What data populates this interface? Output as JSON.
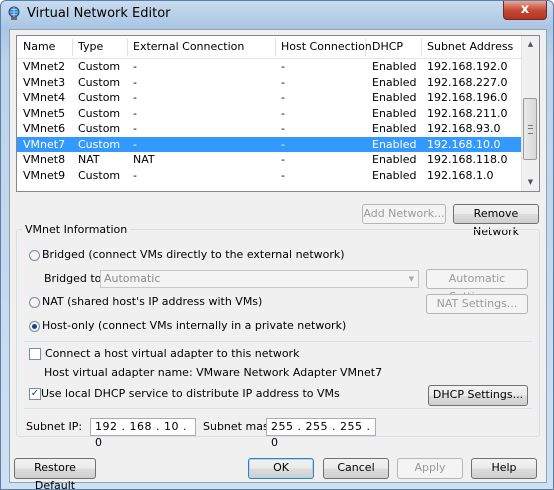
{
  "window": {
    "title": "Virtual Network Editor",
    "close_glyph": "x"
  },
  "table": {
    "headers": [
      "Name",
      "Type",
      "External Connection",
      "Host Connection",
      "DHCP",
      "Subnet Address"
    ],
    "rows": [
      [
        "VMnet2",
        "Custom",
        "-",
        "-",
        "Enabled",
        "192.168.192.0"
      ],
      [
        "VMnet3",
        "Custom",
        "-",
        "-",
        "Enabled",
        "192.168.227.0"
      ],
      [
        "VMnet4",
        "Custom",
        "-",
        "-",
        "Enabled",
        "192.168.196.0"
      ],
      [
        "VMnet5",
        "Custom",
        "-",
        "-",
        "Enabled",
        "192.168.211.0"
      ],
      [
        "VMnet6",
        "Custom",
        "-",
        "-",
        "Enabled",
        "192.168.93.0"
      ],
      [
        "VMnet7",
        "Custom",
        "-",
        "-",
        "Enabled",
        "192.168.10.0"
      ],
      [
        "VMnet8",
        "NAT",
        "NAT",
        "-",
        "Enabled",
        "192.168.118.0"
      ],
      [
        "VMnet9",
        "Custom",
        "-",
        "-",
        "Enabled",
        "192.168.1.0"
      ]
    ],
    "selected_row": "VMnet7"
  },
  "buttons": {
    "add_network": "Add Network...",
    "remove_network": "Remove Network",
    "automatic_settings": "Automatic Settings...",
    "nat_settings": "NAT Settings...",
    "dhcp_settings": "DHCP Settings...",
    "restore_default": "Restore Default",
    "ok": "OK",
    "cancel": "Cancel",
    "apply": "Apply",
    "help": "Help"
  },
  "vmnet_info": {
    "group_title": "VMnet Information",
    "bridged_label": "Bridged (connect VMs directly to the external network)",
    "bridged_to_label": "Bridged to:",
    "bridged_to_value": "Automatic",
    "nat_label": "NAT (shared host's IP address with VMs)",
    "host_only_label": "Host-only (connect VMs internally in a private network)",
    "selected_mode": "host-only",
    "connect_adapter_label": "Connect a host virtual adapter to this network",
    "connect_adapter_checked": false,
    "adapter_name_label": "Host virtual adapter name: VMware Network Adapter VMnet7",
    "use_dhcp_label": "Use local DHCP service to distribute IP address to VMs",
    "use_dhcp_checked": true,
    "checkmark_glyph": "✓",
    "subnet_ip_label": "Subnet IP:",
    "subnet_ip_value": "192 . 168 . 10  .  0",
    "subnet_mask_label": "Subnet mask:",
    "subnet_mask_value": "255 . 255 . 255 .  0"
  },
  "glyphs": {
    "arrow_up": "▲",
    "arrow_down": "▼"
  },
  "colors": {
    "selection": "#3399ff",
    "title_bar": "#aac6e4",
    "close_button": "#c74a36"
  }
}
